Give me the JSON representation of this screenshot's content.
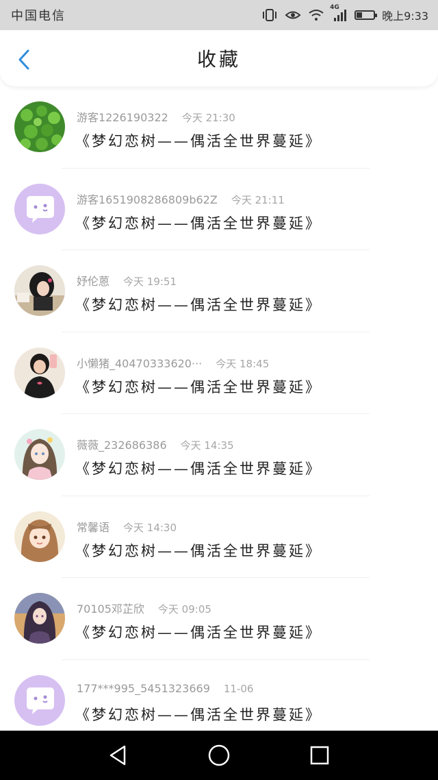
{
  "status_bar": {
    "carrier": "中国电信",
    "network": "4G",
    "time": "晚上9:33",
    "battery_level": 0.35
  },
  "header": {
    "back_icon": "chevron-left-icon",
    "title": "收藏"
  },
  "items": [
    {
      "user": "游客1226190322",
      "time": "今天 21:30",
      "title": "《梦幻恋树——偶活全世界蔓延》",
      "avatar": "clover-photo"
    },
    {
      "user": "游客165190828680​9b62Z",
      "time": "今天 21:11",
      "title": "《梦幻恋树——偶活全世界蔓延》",
      "avatar": "default-chat-avatar"
    },
    {
      "user": "妤伦蒽",
      "time": "今天 19:51",
      "title": "《梦幻恋树——偶活全世界蔓延》",
      "avatar": "girl-photo"
    },
    {
      "user": "小懒猪_40470333620···",
      "time": "今天 18:45",
      "title": "《梦幻恋树——偶活全世界蔓延》",
      "avatar": "selfie-photo"
    },
    {
      "user": "薇薇_232686386",
      "time": "今天 14:35",
      "title": "《梦幻恋树——偶活全世界蔓延》",
      "avatar": "anime-girl-flowers"
    },
    {
      "user": "常馨语",
      "time": "今天 14:30",
      "title": "《梦幻恋树——偶活全世界蔓延》",
      "avatar": "anime-girl-brown-hair"
    },
    {
      "user": "70105邓芷欣",
      "time": "今天 09:05",
      "title": "《梦幻恋树——偶活全世界蔓延》",
      "avatar": "anime-girl-dark"
    },
    {
      "user": "177***995_5451323669",
      "time": "11-06",
      "title": "《梦幻恋树——偶活全世界蔓延》",
      "avatar": "default-chat-avatar"
    }
  ],
  "nav": {
    "back": "triangle-back-icon",
    "home": "circle-home-icon",
    "recent": "square-recent-icon"
  },
  "colors": {
    "accent": "#2e8ddd",
    "status_bar_bg": "#d9d9d9",
    "default_avatar": "#d6c0f2"
  }
}
